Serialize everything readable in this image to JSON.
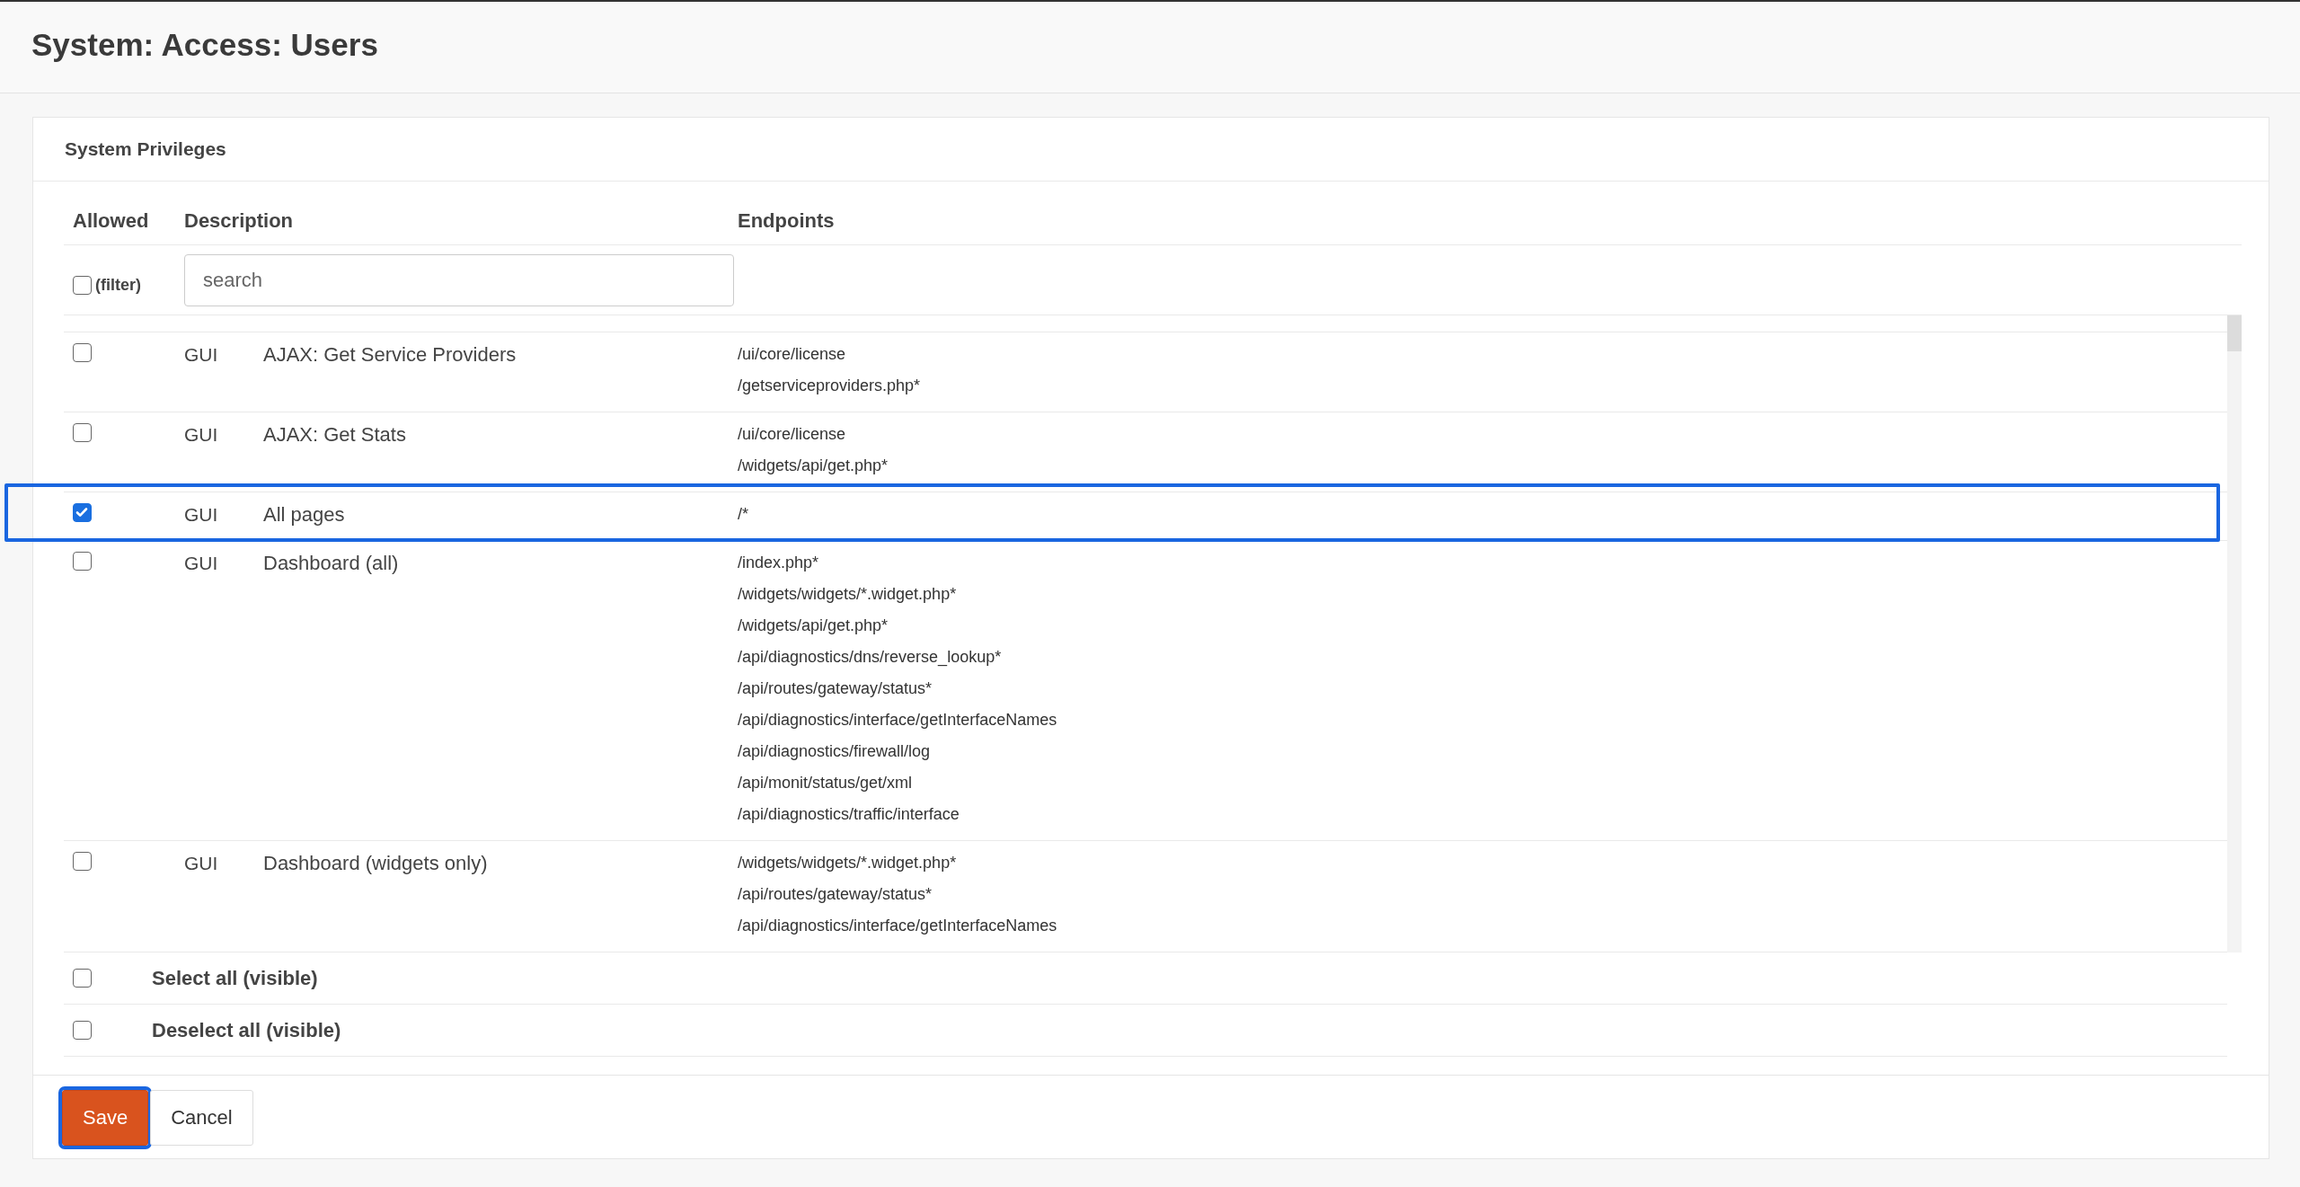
{
  "page_title": "System: Access: Users",
  "card_title": "System Privileges",
  "columns": [
    "Allowed",
    "Description",
    "Endpoints"
  ],
  "filter": {
    "label": "(filter)",
    "checked": false
  },
  "search": {
    "placeholder": "search"
  },
  "rows": [
    {
      "category": "GUI",
      "name": "AJAX: Get Service Providers",
      "endpoints": [
        "/ui/core/license",
        "/getserviceproviders.php*"
      ],
      "checked": false,
      "highlighted": false
    },
    {
      "category": "GUI",
      "name": "AJAX: Get Stats",
      "endpoints": [
        "/ui/core/license",
        "/widgets/api/get.php*"
      ],
      "checked": false,
      "highlighted": false
    },
    {
      "category": "GUI",
      "name": "All pages",
      "endpoints": [
        "/*"
      ],
      "checked": true,
      "highlighted": true
    },
    {
      "category": "GUI",
      "name": "Dashboard (all)",
      "endpoints": [
        "/index.php*",
        "/widgets/widgets/*.widget.php*",
        "/widgets/api/get.php*",
        "/api/diagnostics/dns/reverse_lookup*",
        "/api/routes/gateway/status*",
        "/api/diagnostics/interface/getInterfaceNames",
        "/api/diagnostics/firewall/log",
        "/api/monit/status/get/xml",
        "/api/diagnostics/traffic/interface"
      ],
      "checked": false,
      "highlighted": false
    },
    {
      "category": "GUI",
      "name": "Dashboard (widgets only)",
      "endpoints": [
        "/widgets/widgets/*.widget.php*",
        "/api/routes/gateway/status*",
        "/api/diagnostics/interface/getInterfaceNames"
      ],
      "checked": false,
      "highlighted": false
    }
  ],
  "bulk_actions": [
    {
      "label": "Select all (visible)",
      "checked": false
    },
    {
      "label": "Deselect all (visible)",
      "checked": false
    }
  ],
  "buttons": [
    {
      "label": "Save",
      "kind": "primary",
      "focused": true
    },
    {
      "label": "Cancel",
      "kind": "default",
      "focused": false
    }
  ]
}
